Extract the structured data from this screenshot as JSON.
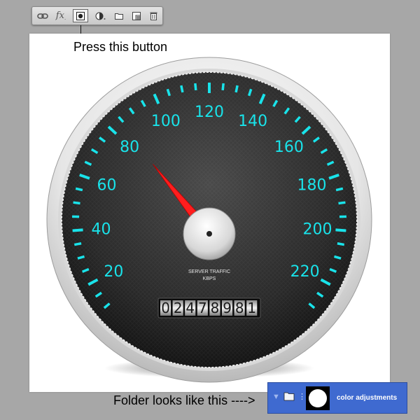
{
  "toolbar": {
    "buttons": [
      {
        "icon": "link-layers-icon",
        "label": ""
      },
      {
        "icon": "fx-icon",
        "label": "fx"
      },
      {
        "icon": "add-layer-mask-icon",
        "label": ""
      },
      {
        "icon": "adjustment-layer-icon",
        "label": ""
      },
      {
        "icon": "new-group-folder-icon",
        "label": ""
      },
      {
        "icon": "new-layer-icon",
        "label": ""
      },
      {
        "icon": "trash-icon",
        "label": ""
      }
    ]
  },
  "instructions": {
    "press_button": "Press this button",
    "folder_hint": "Folder looks like this ---->"
  },
  "gauge": {
    "scale_labels": [
      "20",
      "40",
      "60",
      "80",
      "100",
      "120",
      "140",
      "160",
      "180",
      "200",
      "220"
    ],
    "needle_value": 87,
    "caption_line1": "SERVER TRAFFIC",
    "caption_line2": "KBPS",
    "odometer_digits": [
      "0",
      "2",
      "4",
      "7",
      "8",
      "9",
      "8",
      "1"
    ],
    "colors": {
      "tick": "#19e3ea",
      "needle": "#ff1a1a",
      "face": "#2c2c2c",
      "bezel": "#e8e8e8"
    }
  },
  "layer_row": {
    "label": "color adjustments",
    "highlight_color": "#3f6ad0"
  }
}
